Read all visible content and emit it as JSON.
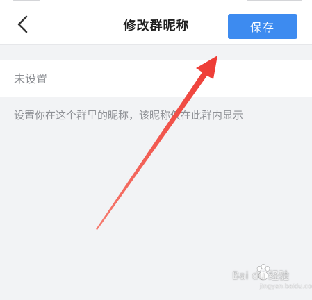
{
  "header": {
    "back_icon": "chevron-left-icon",
    "title": "修改群昵称",
    "save_label": "保存"
  },
  "form": {
    "nickname_value": "",
    "nickname_placeholder": "未设置",
    "hint": "设置你在这个群里的昵称，该昵称仅在此群内显示"
  },
  "annotation": {
    "arrow_color": "#f0443c",
    "arrow_icon": "red-arrow-pointing-save"
  },
  "watermark": {
    "text": "Bai du 经验",
    "subtext": "jingyan.baidu.com"
  },
  "colors": {
    "accent": "#3d8bf0",
    "background": "#f2f3f5",
    "hint": "#8e9095"
  }
}
